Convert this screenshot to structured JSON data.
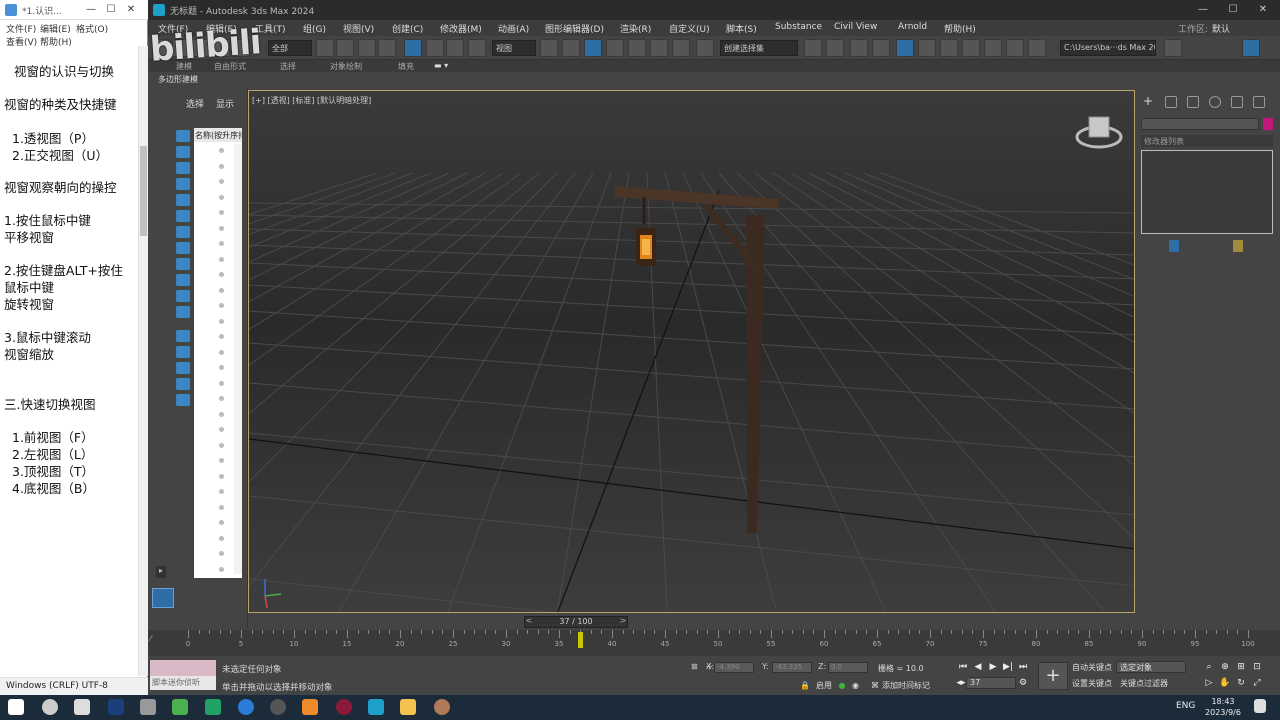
{
  "notepad": {
    "title": "*1.认识...",
    "menu": [
      "文件(F)",
      "编辑(E)",
      "格式(O)",
      "查看(V)",
      "帮助(H)"
    ],
    "lines": [
      "视窗的认识与切换",
      "视窗的种类及快捷键",
      "1.透视图（P）",
      "2.正交视图（U）",
      "视窗观察朝向的操控",
      "1.按住鼠标中键",
      "平移视窗",
      "2.按住键盘ALT+按住",
      "鼠标中键",
      "旋转视窗",
      "3.鼠标中键滚动",
      "视窗缩放",
      "三.快速切换视图",
      "1.前视图（F）",
      "2.左视图（L）",
      "3.顶视图（T）",
      "4.底视图（B）"
    ],
    "status": "Windows (CRLF)  UTF-8"
  },
  "watermark": "bilibili",
  "max": {
    "title": "无标题 - Autodesk 3ds Max 2024",
    "menu": [
      "文件(F)",
      "编辑(E)",
      "工具(T)",
      "组(G)",
      "视图(V)",
      "创建(C)",
      "修改器(M)",
      "动画(A)",
      "图形编辑器(D)",
      "渲染(R)",
      "自定义(U)",
      "脚本(S)",
      "Substance",
      "Civil View",
      "Arnold",
      "帮助(H)"
    ],
    "workspace_label": "工作区:",
    "workspace_value": "默认",
    "toolbar": {
      "selection_filter": "全部",
      "ref_coord": "视图",
      "named_selection": "创建选择集",
      "project_path": "C:\\Users\\ba···ds Max 2024"
    },
    "ribbon_tabs": [
      "建模",
      "自由形式",
      "选择",
      "对象绘制",
      "填充"
    ],
    "ribbon_panel": "多边形建模",
    "explorer": {
      "tabs": [
        "选择",
        "显示"
      ],
      "column_header": "名称(按升序排"
    },
    "viewport": {
      "label": "[+] [透视] [标准] [默认明暗处理]"
    },
    "command_panel": {
      "modifier_list": "修改器列表"
    },
    "timeline": {
      "slider_text": "37 / 100",
      "current_frame": 37,
      "max_frame": 100,
      "tick_labels": [
        "0",
        "5",
        "10",
        "15",
        "20",
        "25",
        "30",
        "35",
        "40",
        "45",
        "50",
        "55",
        "60",
        "65",
        "70",
        "75",
        "80",
        "85",
        "90",
        "95",
        "100"
      ]
    },
    "status": {
      "maxscript_hint": "脚本迷你侦听",
      "msg1": "未选定任何对象",
      "msg2": "单击并拖动以选择并移动对象",
      "x_label": "X:",
      "x_value": "-4.390",
      "y_label": "Y:",
      "y_value": "-43.335",
      "z_label": "Z:",
      "z_value": "0.0",
      "grid": "栅格 = 10.0",
      "add_time_tag": "添加时间标记",
      "enable": "启用",
      "frame_value": "37",
      "auto_key": "自动关键点",
      "set_key": "设置关键点",
      "selected_obj": "选定对象",
      "key_filters": "关键点过滤器"
    }
  },
  "taskbar": {
    "lang": "ENG",
    "time": "18:43",
    "date": "2023/9/6"
  }
}
